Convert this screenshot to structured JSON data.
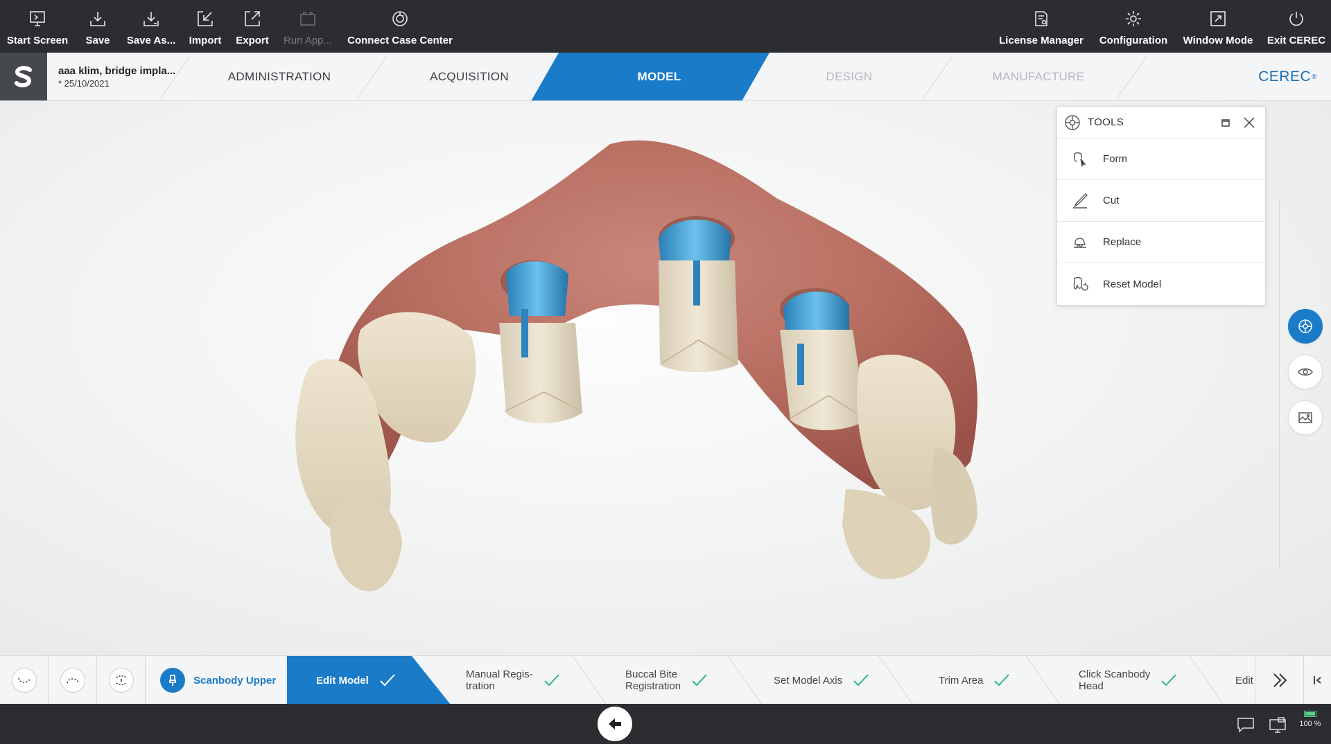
{
  "toolbar": {
    "start_screen": "Start Screen",
    "save": "Save",
    "save_as": "Save As...",
    "import": "Import",
    "export": "Export",
    "run_app": "Run App...",
    "connect_case_center": "Connect Case Center",
    "license_manager": "License Manager",
    "configuration": "Configuration",
    "window_mode": "Window Mode",
    "exit_cerec": "Exit CEREC"
  },
  "case": {
    "name": "aaa klim, bridge impla...",
    "date": "* 25/10/2021"
  },
  "phases": {
    "administration": "ADMINISTRATION",
    "acquisition": "ACQUISITION",
    "model": "MODEL",
    "design": "DESIGN",
    "manufacture": "MANUFACTURE",
    "active": "MODEL"
  },
  "brand": {
    "name": "CEREC",
    "mark": "®"
  },
  "tools_panel": {
    "title": "TOOLS",
    "items": [
      {
        "label": "Form",
        "icon": "form-tool-icon"
      },
      {
        "label": "Cut",
        "icon": "cut-tool-icon"
      },
      {
        "label": "Replace",
        "icon": "replace-tool-icon"
      },
      {
        "label": "Reset Model",
        "icon": "reset-model-icon"
      }
    ]
  },
  "steps": {
    "scanbody_upper": "Scanbody Upper",
    "edit_model": "Edit Model",
    "manual_registration_1": "Manual Regis-",
    "manual_registration_2": "tration",
    "buccal_bite_1": "Buccal Bite",
    "buccal_bite_2": "Registration",
    "set_model_axis": "Set Model Axis",
    "trim_area": "Trim Area",
    "click_scanbody_1": "Click Scanbody",
    "click_scanbody_2": "Head",
    "edit_partial": "Edit"
  },
  "status": {
    "battery_percent": "100 %",
    "battery_level": 1.0
  },
  "colors": {
    "accent": "#1a7cc8",
    "check": "#35b38a",
    "toolbar_bg": "#2b2d30"
  }
}
